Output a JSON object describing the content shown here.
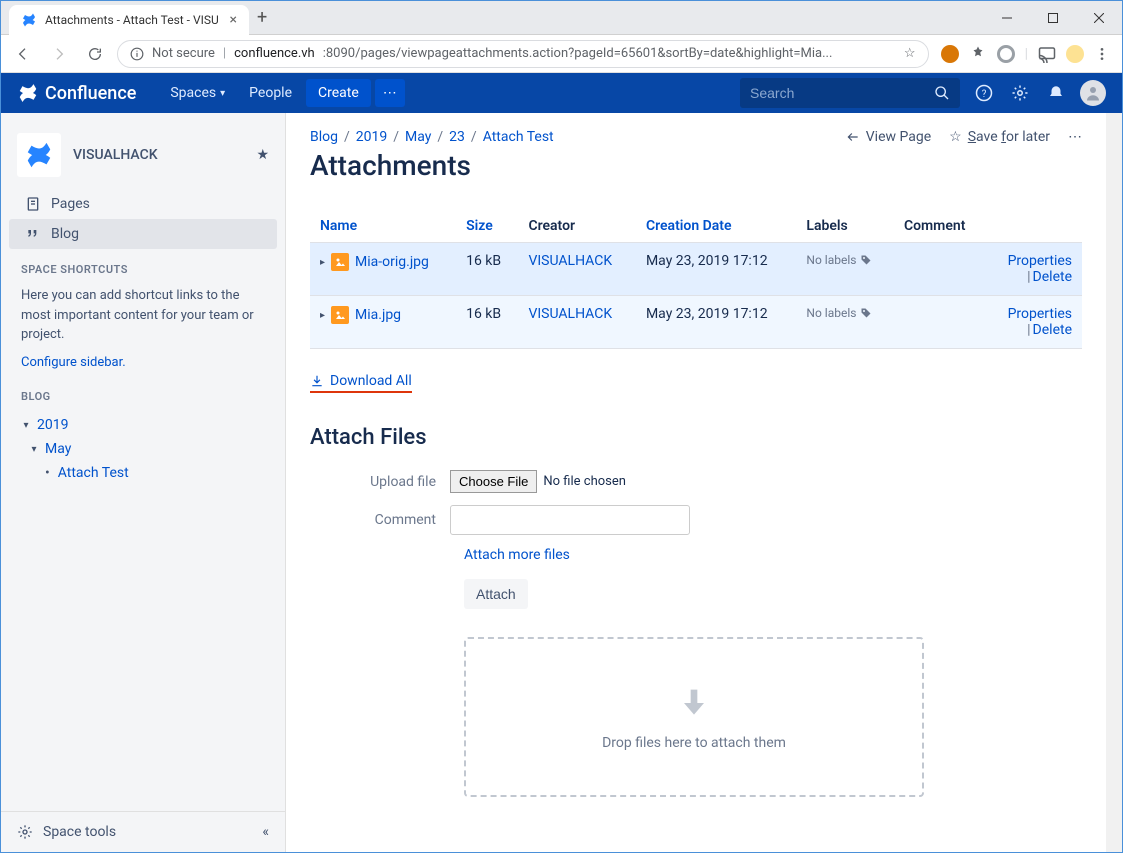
{
  "browser": {
    "tab_title": "Attachments - Attach Test - VISU",
    "url_insecure": "Not secure",
    "url_host": "confluence.vh",
    "url_path": ":8090/pages/viewpageattachments.action?pageId=65601&sortBy=date&highlight=Mia..."
  },
  "topbar": {
    "logo_text": "Confluence",
    "nav_spaces": "Spaces",
    "nav_people": "People",
    "create": "Create",
    "search_placeholder": "Search"
  },
  "sidebar": {
    "space_name": "VISUALHACK",
    "pages": "Pages",
    "blog": "Blog",
    "shortcuts_header": "SPACE SHORTCUTS",
    "shortcuts_text": "Here you can add shortcut links to the most important content for your team or project.",
    "configure": "Configure sidebar.",
    "blog_header": "BLOG",
    "tree_year": "2019",
    "tree_month": "May",
    "tree_page": "Attach Test",
    "space_tools": "Space tools"
  },
  "page": {
    "breadcrumbs": [
      "Blog",
      "2019",
      "May",
      "23",
      "Attach Test"
    ],
    "actions": {
      "view": "View Page",
      "save": "Save for later"
    },
    "title": "Attachments",
    "table": {
      "headers": {
        "name": "Name",
        "size": "Size",
        "creator": "Creator",
        "date": "Creation Date",
        "labels": "Labels",
        "comment": "Comment"
      },
      "rows": [
        {
          "name": "Mia-orig.jpg",
          "size": "16 kB",
          "creator": "VISUALHACK",
          "date": "May 23, 2019 17:12",
          "labels": "No labels",
          "properties": "Properties",
          "delete": "Delete"
        },
        {
          "name": "Mia.jpg",
          "size": "16 kB",
          "creator": "VISUALHACK",
          "date": "May 23, 2019 17:12",
          "labels": "No labels",
          "properties": "Properties",
          "delete": "Delete"
        }
      ]
    },
    "download_all": "Download All",
    "attach_title": "Attach Files",
    "form": {
      "upload_label": "Upload file",
      "choose_file": "Choose File",
      "no_file": "No file chosen",
      "comment_label": "Comment",
      "attach_more": "Attach more files",
      "attach_btn": "Attach",
      "drop_hint": "Drop files here to attach them"
    }
  }
}
